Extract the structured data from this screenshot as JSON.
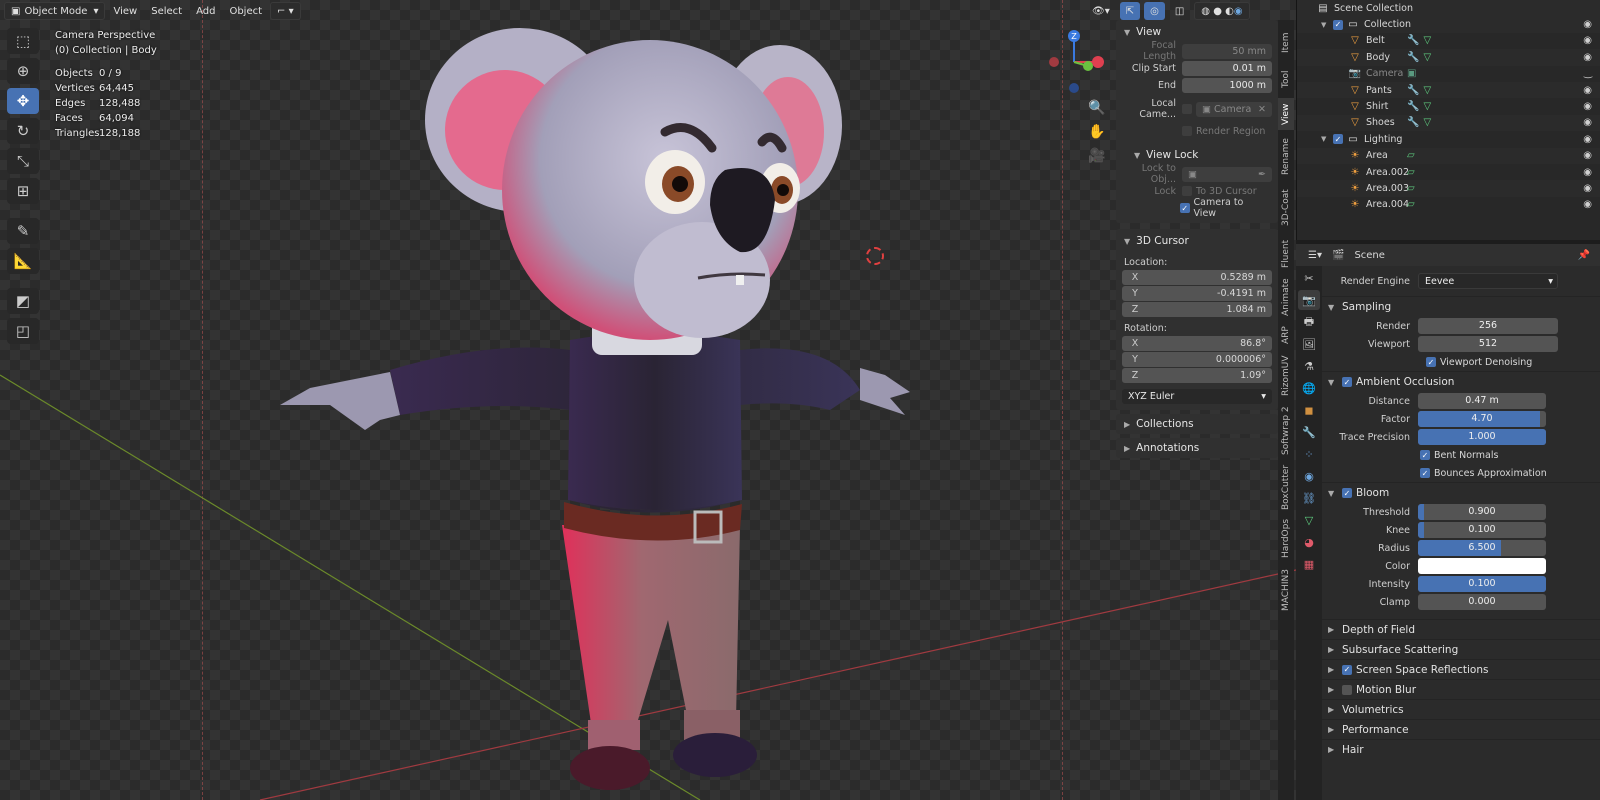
{
  "header": {
    "mode": "Object Mode",
    "menus": [
      "View",
      "Select",
      "Add",
      "Object"
    ]
  },
  "viewport": {
    "title": "Camera Perspective",
    "collection": "(0) Collection | Body",
    "stats": [
      {
        "label": "Objects",
        "value": "0 / 9"
      },
      {
        "label": "Vertices",
        "value": "64,445"
      },
      {
        "label": "Edges",
        "value": "128,488"
      },
      {
        "label": "Faces",
        "value": "64,094"
      },
      {
        "label": "Triangles",
        "value": "128,188"
      }
    ],
    "gizmo_axis": "Z"
  },
  "npanel": {
    "view": {
      "title": "View",
      "focal_length_label": "Focal Length",
      "focal_length": "50 mm",
      "clip_start_label": "Clip Start",
      "clip_start": "0.01 m",
      "end_label": "End",
      "end": "1000 m",
      "local_camera_label": "Local Came...",
      "local_camera": "Camera",
      "render_region": "Render Region",
      "view_lock": "View Lock",
      "lock_to_obj": "Lock to Obj...",
      "lock_label": "Lock",
      "to_3d_cursor": "To 3D Cursor",
      "camera_to_view": "Camera to View"
    },
    "cursor": {
      "title": "3D Cursor",
      "location_label": "Location:",
      "loc": [
        {
          "k": "X",
          "v": "0.5289 m"
        },
        {
          "k": "Y",
          "v": "-0.4191 m"
        },
        {
          "k": "Z",
          "v": "1.084 m"
        }
      ],
      "rotation_label": "Rotation:",
      "rot": [
        {
          "k": "X",
          "v": "86.8°"
        },
        {
          "k": "Y",
          "v": "0.000006°"
        },
        {
          "k": "Z",
          "v": "1.09°"
        }
      ],
      "euler": "XYZ Euler"
    },
    "collections": "Collections",
    "annotations": "Annotations"
  },
  "vtabs": [
    "Item",
    "Tool",
    "View",
    "Rename",
    "3D-Coat",
    "Fluent",
    "Animate",
    "ARP",
    "RizomUV",
    "Softwrap 2",
    "BoxCutter",
    "HardOps",
    "MACHIN3"
  ],
  "outliner": {
    "root": "Scene Collection",
    "rows": [
      {
        "name": "Collection",
        "indent": 1,
        "type": "collection"
      },
      {
        "name": "Belt",
        "indent": 2,
        "type": "mesh"
      },
      {
        "name": "Body",
        "indent": 2,
        "type": "mesh"
      },
      {
        "name": "Camera",
        "indent": 2,
        "type": "camera"
      },
      {
        "name": "Pants",
        "indent": 2,
        "type": "mesh"
      },
      {
        "name": "Shirt",
        "indent": 2,
        "type": "mesh"
      },
      {
        "name": "Shoes",
        "indent": 2,
        "type": "mesh"
      },
      {
        "name": "Lighting",
        "indent": 1,
        "type": "collection"
      },
      {
        "name": "Area",
        "indent": 2,
        "type": "light"
      },
      {
        "name": "Area.002",
        "indent": 2,
        "type": "light"
      },
      {
        "name": "Area.003",
        "indent": 2,
        "type": "light"
      },
      {
        "name": "Area.004",
        "indent": 2,
        "type": "light"
      }
    ]
  },
  "properties": {
    "scene": "Scene",
    "render_engine_label": "Render Engine",
    "render_engine": "Eevee",
    "sampling": {
      "title": "Sampling",
      "render_label": "Render",
      "render": "256",
      "viewport_label": "Viewport",
      "viewport": "512",
      "denoise": "Viewport Denoising"
    },
    "ao": {
      "title": "Ambient Occlusion",
      "distance_label": "Distance",
      "distance": "0.47 m",
      "factor_label": "Factor",
      "factor": "4.70",
      "factor_fill": 0.95,
      "trace_label": "Trace Precision",
      "trace": "1.000",
      "trace_fill": 1.0,
      "bent": "Bent Normals",
      "bounces": "Bounces Approximation"
    },
    "bloom": {
      "title": "Bloom",
      "threshold_label": "Threshold",
      "threshold": "0.900",
      "threshold_fill": 0.05,
      "knee_label": "Knee",
      "knee": "0.100",
      "knee_fill": 0.05,
      "radius_label": "Radius",
      "radius": "6.500",
      "radius_fill": 0.65,
      "color_label": "Color",
      "intensity_label": "Intensity",
      "intensity": "0.100",
      "intensity_fill": 1.0,
      "clamp_label": "Clamp",
      "clamp": "0.000"
    },
    "panels": [
      {
        "name": "Depth of Field",
        "check": null
      },
      {
        "name": "Subsurface Scattering",
        "check": null
      },
      {
        "name": "Screen Space Reflections",
        "check": true
      },
      {
        "name": "Motion Blur",
        "check": false
      },
      {
        "name": "Volumetrics",
        "check": null
      },
      {
        "name": "Performance",
        "check": null
      },
      {
        "name": "Hair",
        "check": null
      }
    ]
  }
}
